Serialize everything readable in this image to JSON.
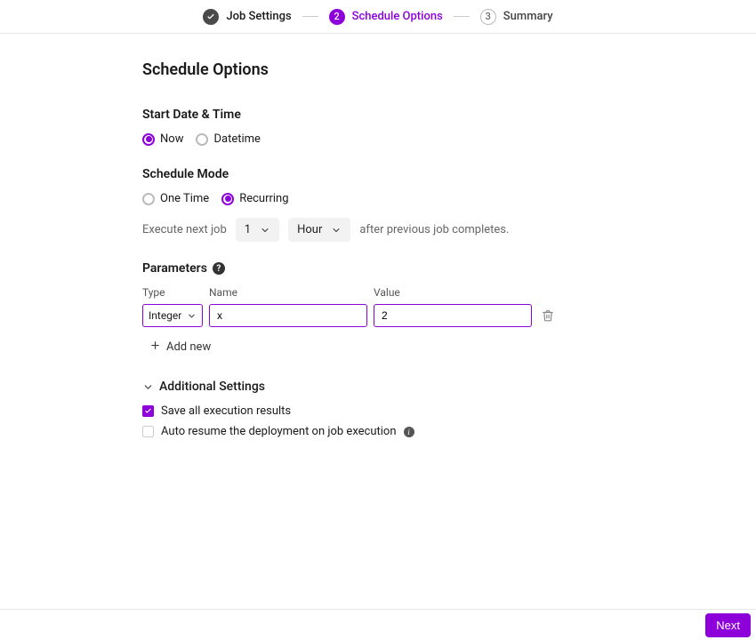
{
  "colors": {
    "accent": "#8e00d9"
  },
  "stepper": {
    "steps": [
      {
        "label": "Job Settings",
        "state": "done"
      },
      {
        "label": "Schedule Options",
        "state": "active",
        "num": "2"
      },
      {
        "label": "Summary",
        "state": "pending",
        "num": "3"
      }
    ]
  },
  "page_title": "Schedule Options",
  "start_section": {
    "title": "Start Date & Time",
    "options": {
      "now": "Now",
      "datetime": "Datetime"
    },
    "selected": "now"
  },
  "mode_section": {
    "title": "Schedule Mode",
    "options": {
      "one_time": "One Time",
      "recurring": "Recurring"
    },
    "selected": "recurring",
    "exec_prefix": "Execute next job",
    "exec_interval_value": "1",
    "exec_interval_unit": "Hour",
    "exec_suffix": "after previous job completes."
  },
  "params": {
    "title": "Parameters",
    "headers": {
      "type": "Type",
      "name": "Name",
      "value": "Value"
    },
    "rows": [
      {
        "type": "Integer",
        "name": "x",
        "value": "2"
      }
    ],
    "add_new_label": "Add new"
  },
  "additional": {
    "title": "Additional Settings",
    "save_results": {
      "label": "Save all execution results",
      "checked": true
    },
    "auto_resume": {
      "label": "Auto resume the deployment on job execution",
      "checked": false
    }
  },
  "footer": {
    "next": "Next"
  }
}
